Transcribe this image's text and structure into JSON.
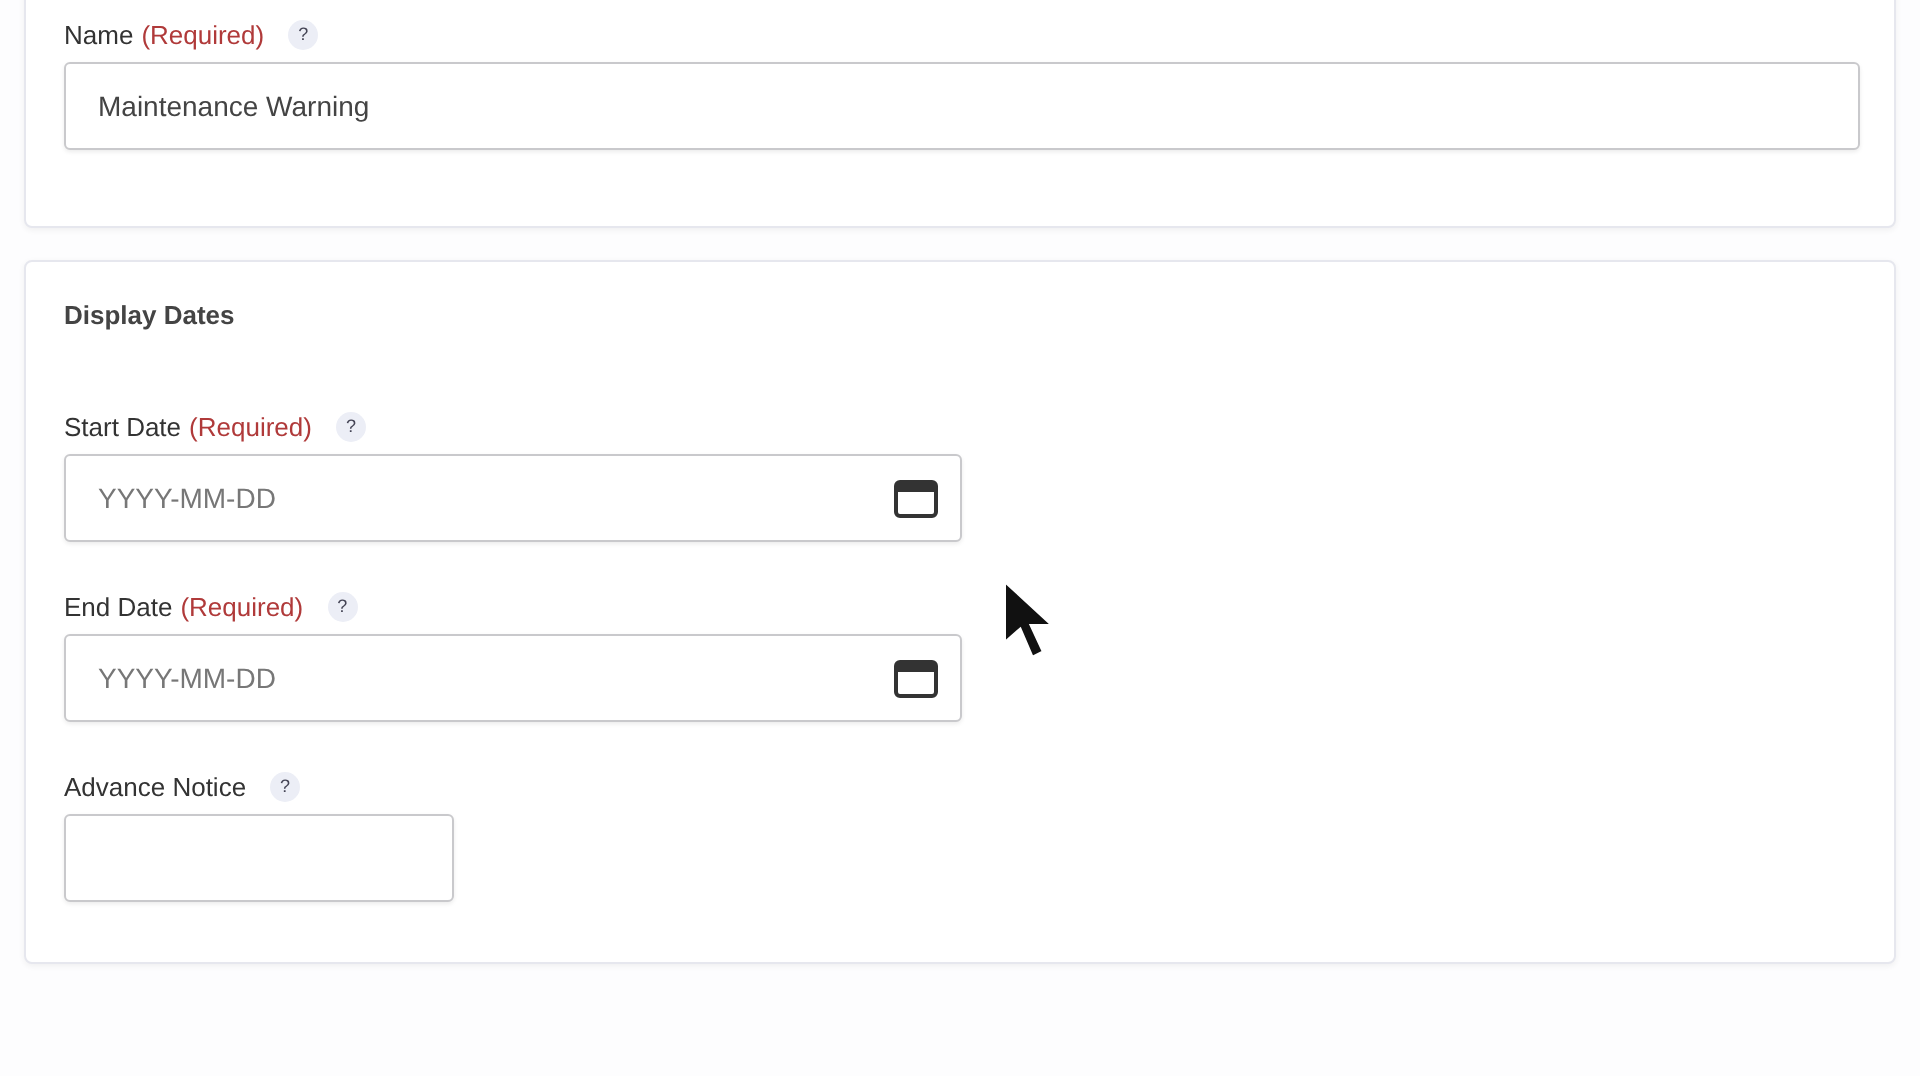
{
  "sections": [
    {
      "fields": [
        {
          "kind": "text",
          "label": "Name",
          "required": "(Required)",
          "help": "?",
          "value": "Maintenance Warning"
        }
      ]
    },
    {
      "heading": "Display Dates",
      "fields": [
        {
          "kind": "date",
          "label": "Start Date",
          "required": "(Required)",
          "help": "?",
          "placeholder": "YYYY-MM-DD"
        },
        {
          "kind": "date",
          "label": "End Date",
          "required": "(Required)",
          "help": "?",
          "placeholder": "YYYY-MM-DD"
        },
        {
          "kind": "text",
          "label": "Advance Notice",
          "help": "?"
        }
      ]
    }
  ]
}
